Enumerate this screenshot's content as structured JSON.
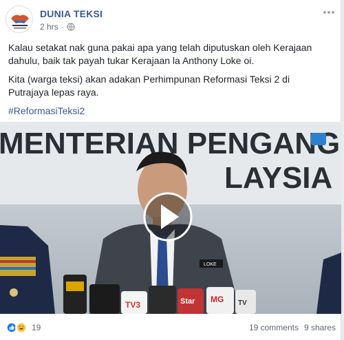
{
  "post": {
    "page_name": "DUNIA TEKSI",
    "time": "2 hrs",
    "separator": "·",
    "paragraphs": [
      "Kalau setakat nak guna pakai apa yang telah diputuskan oleh Kerajaan dahulu, baik tak payah tukar Kerajaan la Anthony Loke oi.",
      "Kita (warga teksi) akan adakan Perhimpunan Reformasi Teksi 2 di Putrajaya lepas raya."
    ],
    "hashtag": "#ReformasiTeksi2"
  },
  "video": {
    "banner_text": "MENTERIAN PENGANG",
    "banner_text2": "LAYSIA",
    "name_plate": "LOKE",
    "mic_logos": [
      "TV3",
      "Star",
      "MG",
      "TV"
    ],
    "play_icon": "play-icon"
  },
  "footer": {
    "reaction_count": "19",
    "comments": "19 comments",
    "shares": "9 shares"
  },
  "colors": {
    "brand": "#385898",
    "text": "#1d2129",
    "meta": "#616770"
  }
}
